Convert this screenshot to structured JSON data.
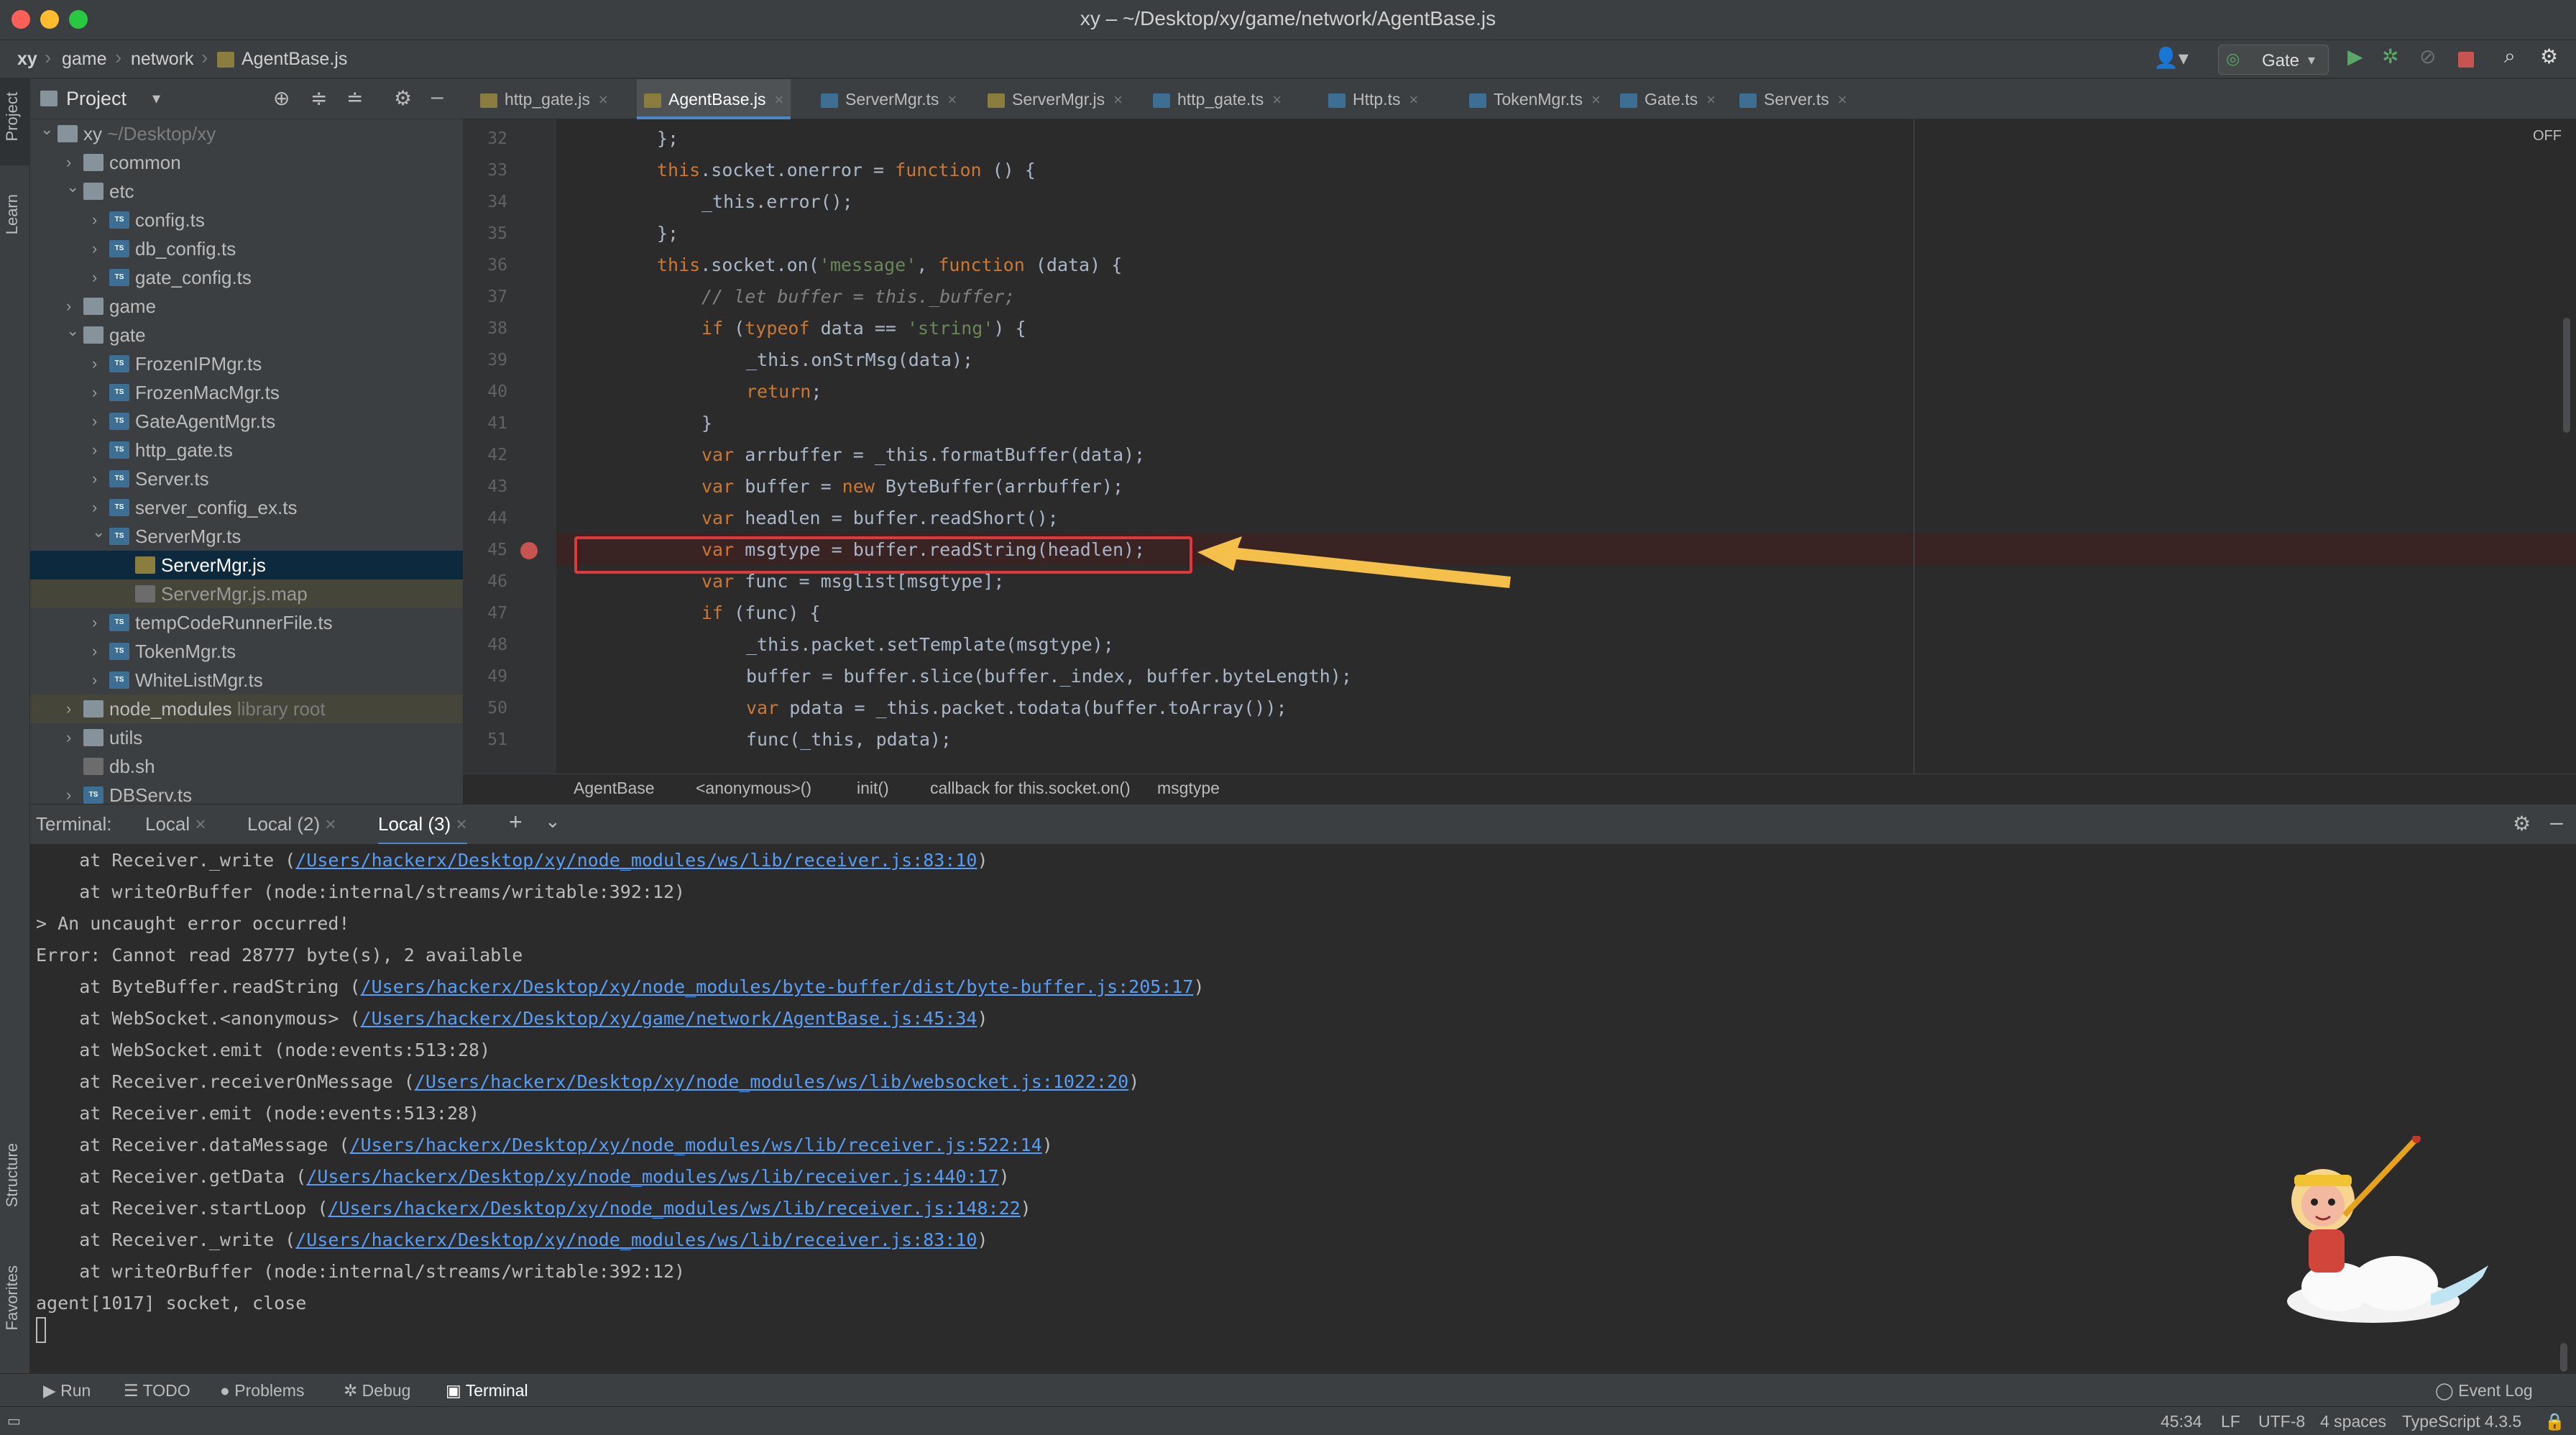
{
  "window": {
    "title": "xy – ~/Desktop/xy/game/network/AgentBase.js"
  },
  "breadcrumb": [
    "xy",
    "game",
    "network",
    "AgentBase.js"
  ],
  "toolbar": {
    "run_config": "Gate"
  },
  "side_tabs": {
    "project": "Project",
    "learn": "Learn",
    "structure": "Structure",
    "favorites": "Favorites"
  },
  "project_panel": {
    "title": "Project",
    "tree": [
      {
        "label": "xy",
        "hint": "~/Desktop/xy",
        "depth": 0,
        "kind": "folder",
        "expanded": true
      },
      {
        "label": "common",
        "depth": 1,
        "kind": "folder",
        "expanded": false
      },
      {
        "label": "etc",
        "depth": 1,
        "kind": "folder",
        "expanded": true
      },
      {
        "label": "config.ts",
        "depth": 2,
        "kind": "ts",
        "expanded": false
      },
      {
        "label": "db_config.ts",
        "depth": 2,
        "kind": "ts",
        "expanded": false
      },
      {
        "label": "gate_config.ts",
        "depth": 2,
        "kind": "ts",
        "expanded": false
      },
      {
        "label": "game",
        "depth": 1,
        "kind": "folder",
        "expanded": false
      },
      {
        "label": "gate",
        "depth": 1,
        "kind": "folder",
        "expanded": true
      },
      {
        "label": "FrozenIPMgr.ts",
        "depth": 2,
        "kind": "ts",
        "expanded": false
      },
      {
        "label": "FrozenMacMgr.ts",
        "depth": 2,
        "kind": "ts",
        "expanded": false
      },
      {
        "label": "GateAgentMgr.ts",
        "depth": 2,
        "kind": "ts",
        "expanded": false
      },
      {
        "label": "http_gate.ts",
        "depth": 2,
        "kind": "ts",
        "expanded": false
      },
      {
        "label": "Server.ts",
        "depth": 2,
        "kind": "ts",
        "expanded": false
      },
      {
        "label": "server_config_ex.ts",
        "depth": 2,
        "kind": "ts",
        "expanded": false
      },
      {
        "label": "ServerMgr.ts",
        "depth": 2,
        "kind": "ts",
        "expanded": true
      },
      {
        "label": "ServerMgr.js",
        "depth": 3,
        "kind": "js",
        "selected": true
      },
      {
        "label": "ServerMgr.js.map",
        "depth": 3,
        "kind": "map",
        "muted": true
      },
      {
        "label": "tempCodeRunnerFile.ts",
        "depth": 2,
        "kind": "ts",
        "expanded": false
      },
      {
        "label": "TokenMgr.ts",
        "depth": 2,
        "kind": "ts",
        "expanded": false
      },
      {
        "label": "WhiteListMgr.ts",
        "depth": 2,
        "kind": "ts",
        "expanded": false
      },
      {
        "label": "node_modules",
        "hint": "library root",
        "depth": 1,
        "kind": "folder",
        "expanded": false,
        "muted": true
      },
      {
        "label": "utils",
        "depth": 1,
        "kind": "folder",
        "expanded": false
      },
      {
        "label": "db.sh",
        "depth": 1,
        "kind": "file"
      },
      {
        "label": "DBServ.ts",
        "depth": 1,
        "kind": "ts",
        "expanded": false
      }
    ]
  },
  "editor_tabs": [
    {
      "label": "http_gate.js",
      "kind": "js"
    },
    {
      "label": "AgentBase.js",
      "kind": "js",
      "active": true
    },
    {
      "label": "ServerMgr.ts",
      "kind": "ts"
    },
    {
      "label": "ServerMgr.js",
      "kind": "js"
    },
    {
      "label": "http_gate.ts",
      "kind": "ts"
    },
    {
      "label": "Http.ts",
      "kind": "ts"
    },
    {
      "label": "TokenMgr.ts",
      "kind": "ts"
    },
    {
      "label": "Gate.ts",
      "kind": "ts"
    },
    {
      "label": "Server.ts",
      "kind": "ts"
    }
  ],
  "editor": {
    "off_label": "OFF",
    "lines": [
      {
        "n": "32",
        "indent": 0,
        "tokens": [
          [
            "pl",
            "};"
          ]
        ]
      },
      {
        "n": "33",
        "indent": 0,
        "tokens": [
          [
            "kw",
            "this"
          ],
          [
            "pl",
            ".socket.onerror = "
          ],
          [
            "kw",
            "function"
          ],
          [
            "pl",
            " () {"
          ]
        ]
      },
      {
        "n": "34",
        "indent": 1,
        "tokens": [
          [
            "pl",
            "_this.error();"
          ]
        ]
      },
      {
        "n": "35",
        "indent": 0,
        "tokens": [
          [
            "pl",
            "};"
          ]
        ]
      },
      {
        "n": "36",
        "indent": 0,
        "tokens": [
          [
            "kw",
            "this"
          ],
          [
            "pl",
            ".socket.on("
          ],
          [
            "str",
            "'message'"
          ],
          [
            "pl",
            ", "
          ],
          [
            "kw",
            "function"
          ],
          [
            "pl",
            " (data) {"
          ]
        ]
      },
      {
        "n": "37",
        "indent": 1,
        "tokens": [
          [
            "cm",
            "// let buffer = this._buffer;"
          ]
        ]
      },
      {
        "n": "38",
        "indent": 1,
        "tokens": [
          [
            "kw",
            "if"
          ],
          [
            "pl",
            " ("
          ],
          [
            "kw",
            "typeof"
          ],
          [
            "pl",
            " data == "
          ],
          [
            "str",
            "'string'"
          ],
          [
            "pl",
            ") {"
          ]
        ]
      },
      {
        "n": "39",
        "indent": 2,
        "tokens": [
          [
            "pl",
            "_this.onStrMsg(data);"
          ]
        ]
      },
      {
        "n": "40",
        "indent": 2,
        "tokens": [
          [
            "kw",
            "return"
          ],
          [
            "pl",
            ";"
          ]
        ]
      },
      {
        "n": "41",
        "indent": 1,
        "tokens": [
          [
            "pl",
            "}"
          ]
        ]
      },
      {
        "n": "42",
        "indent": 1,
        "tokens": [
          [
            "kw",
            "var"
          ],
          [
            "pl",
            " arrbuffer = _this.formatBuffer(data);"
          ]
        ]
      },
      {
        "n": "43",
        "indent": 1,
        "tokens": [
          [
            "kw",
            "var"
          ],
          [
            "pl",
            " buffer = "
          ],
          [
            "kw",
            "new"
          ],
          [
            "pl",
            " ByteBuffer(arrbuffer);"
          ]
        ]
      },
      {
        "n": "44",
        "indent": 1,
        "tokens": [
          [
            "kw",
            "var"
          ],
          [
            "pl",
            " headlen = buffer.readShort();"
          ]
        ]
      },
      {
        "n": "45",
        "indent": 1,
        "tokens": [
          [
            "kw",
            "var"
          ],
          [
            "pl",
            " msgtype = buffer.readString(headlen);"
          ]
        ],
        "breakpoint": true
      },
      {
        "n": "46",
        "indent": 1,
        "tokens": [
          [
            "kw",
            "var"
          ],
          [
            "pl",
            " func = msglist[msgtype];"
          ]
        ]
      },
      {
        "n": "47",
        "indent": 1,
        "tokens": [
          [
            "kw",
            "if"
          ],
          [
            "pl",
            " (func) {"
          ]
        ]
      },
      {
        "n": "48",
        "indent": 2,
        "tokens": [
          [
            "pl",
            "_this.packet.setTemplate(msgtype);"
          ]
        ]
      },
      {
        "n": "49",
        "indent": 2,
        "tokens": [
          [
            "pl",
            "buffer = buffer.slice(buffer._index, buffer.byteLength);"
          ]
        ]
      },
      {
        "n": "50",
        "indent": 2,
        "tokens": [
          [
            "kw",
            "var"
          ],
          [
            "pl",
            " pdata = _this.packet.todata(buffer.toArray());"
          ]
        ]
      },
      {
        "n": "51",
        "indent": 2,
        "tokens": [
          [
            "pl",
            "func(_this, pdata);"
          ]
        ]
      }
    ]
  },
  "code_breadcrumb": [
    "AgentBase",
    "<anonymous>()",
    "init()",
    "callback for this.socket.on()",
    "msgtype"
  ],
  "terminal": {
    "label": "Terminal:",
    "tabs": [
      "Local",
      "Local (2)",
      "Local (3)"
    ],
    "active_tab": 2,
    "lines": [
      {
        "pre": "    at Receiver._write (",
        "link": "/Users/hackerx/Desktop/xy/node_modules/ws/lib/receiver.js:83:10",
        "post": ")"
      },
      {
        "pre": "    at writeOrBuffer (node:internal/streams/writable:392:12)"
      },
      {
        "pre": "> An uncaught error occurred!"
      },
      {
        "pre": "Error: Cannot read 28777 byte(s), 2 available"
      },
      {
        "pre": "    at ByteBuffer.readString (",
        "link": "/Users/hackerx/Desktop/xy/node_modules/byte-buffer/dist/byte-buffer.js:205:17",
        "post": ")"
      },
      {
        "pre": "    at WebSocket.<anonymous> (",
        "link": "/Users/hackerx/Desktop/xy/game/network/AgentBase.js:45:34",
        "post": ")"
      },
      {
        "pre": "    at WebSocket.emit (node:events:513:28)"
      },
      {
        "pre": "    at Receiver.receiverOnMessage (",
        "link": "/Users/hackerx/Desktop/xy/node_modules/ws/lib/websocket.js:1022:20",
        "post": ")"
      },
      {
        "pre": "    at Receiver.emit (node:events:513:28)"
      },
      {
        "pre": "    at Receiver.dataMessage (",
        "link": "/Users/hackerx/Desktop/xy/node_modules/ws/lib/receiver.js:522:14",
        "post": ")"
      },
      {
        "pre": "    at Receiver.getData (",
        "link": "/Users/hackerx/Desktop/xy/node_modules/ws/lib/receiver.js:440:17",
        "post": ")"
      },
      {
        "pre": "    at Receiver.startLoop (",
        "link": "/Users/hackerx/Desktop/xy/node_modules/ws/lib/receiver.js:148:22",
        "post": ")"
      },
      {
        "pre": "    at Receiver._write (",
        "link": "/Users/hackerx/Desktop/xy/node_modules/ws/lib/receiver.js:83:10",
        "post": ")"
      },
      {
        "pre": "    at writeOrBuffer (node:internal/streams/writable:392:12)"
      },
      {
        "pre": "agent[1017] socket, close"
      }
    ]
  },
  "tool_windows": {
    "run": "Run",
    "todo": "TODO",
    "problems": "Problems",
    "debug": "Debug",
    "terminal": "Terminal",
    "event_log": "Event Log"
  },
  "status": {
    "position": "45:34",
    "line_sep": "LF",
    "encoding": "UTF-8",
    "indent": "4 spaces",
    "language": "TypeScript 4.3.5"
  },
  "colors": {
    "breakpoint": "#e0383a",
    "highlight_box": "#e0383a",
    "arrow": "#f5c04a",
    "link": "#589df6",
    "selection": "#0d293e"
  }
}
